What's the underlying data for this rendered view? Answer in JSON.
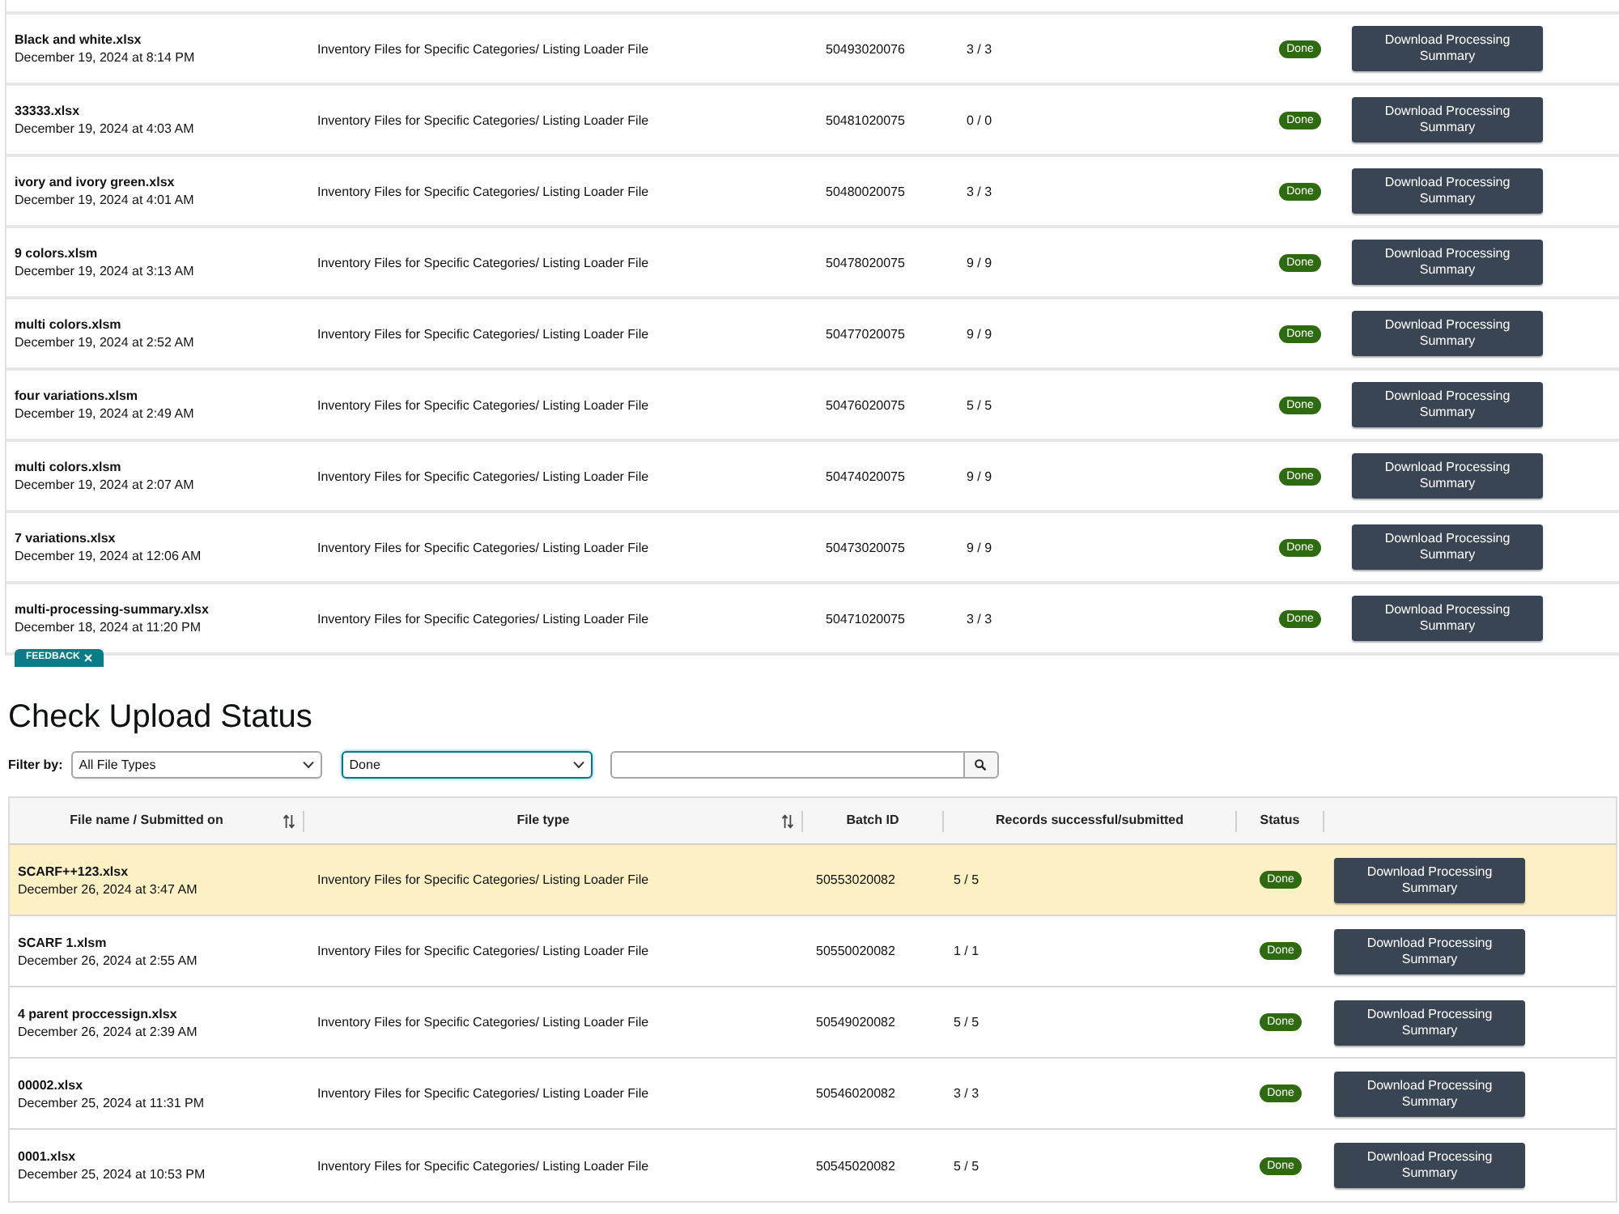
{
  "previous_table": {
    "rows": [
      {
        "file_name": "Black and white.xlsx",
        "submitted_on": "December 19, 2024 at 8:14 PM",
        "file_type": "Inventory Files for Specific Categories/ Listing Loader File",
        "batch_id": "50493020076",
        "records": "3 / 3",
        "status": "Done",
        "action": "Download Processing Summary"
      },
      {
        "file_name": "33333.xlsx",
        "submitted_on": "December 19, 2024 at 4:03 AM",
        "file_type": "Inventory Files for Specific Categories/ Listing Loader File",
        "batch_id": "50481020075",
        "records": "0 / 0",
        "status": "Done",
        "action": "Download Processing Summary"
      },
      {
        "file_name": "ivory and ivory green.xlsx",
        "submitted_on": "December 19, 2024 at 4:01 AM",
        "file_type": "Inventory Files for Specific Categories/ Listing Loader File",
        "batch_id": "50480020075",
        "records": "3 / 3",
        "status": "Done",
        "action": "Download Processing Summary"
      },
      {
        "file_name": "9 colors.xlsm",
        "submitted_on": "December 19, 2024 at 3:13 AM",
        "file_type": "Inventory Files for Specific Categories/ Listing Loader File",
        "batch_id": "50478020075",
        "records": "9 / 9",
        "status": "Done",
        "action": "Download Processing Summary"
      },
      {
        "file_name": "multi colors.xlsm",
        "submitted_on": "December 19, 2024 at 2:52 AM",
        "file_type": "Inventory Files for Specific Categories/ Listing Loader File",
        "batch_id": "50477020075",
        "records": "9 / 9",
        "status": "Done",
        "action": "Download Processing Summary"
      },
      {
        "file_name": "four variations.xlsm",
        "submitted_on": "December 19, 2024 at 2:49 AM",
        "file_type": "Inventory Files for Specific Categories/ Listing Loader File",
        "batch_id": "50476020075",
        "records": "5 / 5",
        "status": "Done",
        "action": "Download Processing Summary"
      },
      {
        "file_name": "multi colors.xlsm",
        "submitted_on": "December 19, 2024 at 2:07 AM",
        "file_type": "Inventory Files for Specific Categories/ Listing Loader File",
        "batch_id": "50474020075",
        "records": "9 / 9",
        "status": "Done",
        "action": "Download Processing Summary"
      },
      {
        "file_name": "7 variations.xlsx",
        "submitted_on": "December 19, 2024 at 12:06 AM",
        "file_type": "Inventory Files for Specific Categories/ Listing Loader File",
        "batch_id": "50473020075",
        "records": "9 / 9",
        "status": "Done",
        "action": "Download Processing Summary"
      },
      {
        "file_name": "multi-processing-summary.xlsx",
        "submitted_on": "December 18, 2024 at 11:20 PM",
        "file_type": "Inventory Files for Specific Categories/ Listing Loader File",
        "batch_id": "50471020075",
        "records": "3 / 3",
        "status": "Done",
        "action": "Download Processing Summary"
      }
    ]
  },
  "feedback_tab": {
    "label": "FEEDBACK"
  },
  "upload_status": {
    "title": "Check Upload Status",
    "filter_label": "Filter by:",
    "filters": [
      {
        "value": "All File Types",
        "focused": false
      },
      {
        "value": "Done",
        "focused": true
      }
    ]
  },
  "table": {
    "columns": [
      {
        "label": "File name / Submitted on",
        "sortable": true
      },
      {
        "label": "File type",
        "sortable": true
      },
      {
        "label": "Batch ID",
        "sortable": false
      },
      {
        "label": "Records successful/submitted",
        "sortable": false
      },
      {
        "label": "Status",
        "sortable": false
      }
    ],
    "rows": [
      {
        "file_name": "SCARF++123.xlsx",
        "submitted_on": "December 26, 2024 at 3:47 AM",
        "file_type": "Inventory Files for Specific Categories/ Listing Loader File",
        "batch_id": "50553020082",
        "records": "5 / 5",
        "status": "Done",
        "action": "Download Processing Summary",
        "selected": true
      },
      {
        "file_name": "SCARF 1.xlsm",
        "submitted_on": "December 26, 2024 at 2:55 AM",
        "file_type": "Inventory Files for Specific Categories/ Listing Loader File",
        "batch_id": "50550020082",
        "records": "1 / 1",
        "status": "Done",
        "action": "Download Processing Summary",
        "selected": false
      },
      {
        "file_name": "4 parent proccessign.xlsx",
        "submitted_on": "December 26, 2024 at 2:39 AM",
        "file_type": "Inventory Files for Specific Categories/ Listing Loader File",
        "batch_id": "50549020082",
        "records": "5 / 5",
        "status": "Done",
        "action": "Download Processing Summary",
        "selected": false
      },
      {
        "file_name": "00002.xlsx",
        "submitted_on": "December 25, 2024 at 11:31 PM",
        "file_type": "Inventory Files for Specific Categories/ Listing Loader File",
        "batch_id": "50546020082",
        "records": "3 / 3",
        "status": "Done",
        "action": "Download Processing Summary",
        "selected": false
      },
      {
        "file_name": "0001.xlsx",
        "submitted_on": "December 25, 2024 at 10:53 PM",
        "file_type": "Inventory Files for Specific Categories/ Listing Loader File",
        "batch_id": "50545020082",
        "records": "5 / 5",
        "status": "Done",
        "action": "Download Processing Summary",
        "selected": false
      }
    ]
  }
}
